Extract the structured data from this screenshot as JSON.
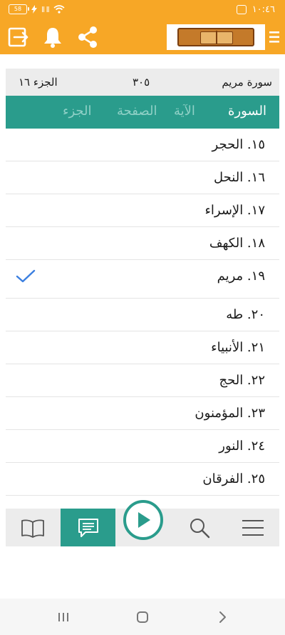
{
  "status_bar": {
    "battery": "58",
    "time": "١٠:٤٦",
    "signal": "ll ll",
    "icons": [
      "battery-icon",
      "bolt-icon",
      "signal-icon",
      "wifi-icon",
      "screen-record-icon"
    ]
  },
  "header": {
    "icons": [
      "exit-icon",
      "bell-icon",
      "share-icon",
      "app-logo",
      "menu-icon"
    ]
  },
  "info": {
    "sura": "سورة مريم",
    "page": "٣٠٥",
    "juz": "الجزء ١٦"
  },
  "tabs": [
    {
      "label": "السورة",
      "active": true
    },
    {
      "label": "الآية",
      "active": false
    },
    {
      "label": "الصفحة",
      "active": false
    },
    {
      "label": "الجزء",
      "active": false
    }
  ],
  "surahs": [
    {
      "label": "١٥. الحجر"
    },
    {
      "label": "١٦. النحل"
    },
    {
      "label": "١٧. الإسراء"
    },
    {
      "label": "١٨. الكهف"
    },
    {
      "label": "١٩. مريم",
      "selected": true
    },
    {
      "label": "٢٠. طه"
    },
    {
      "label": "٢١. الأنبياء"
    },
    {
      "label": "٢٢. الحج"
    },
    {
      "label": "٢٣. المؤمنون"
    },
    {
      "label": "٢٤. النور"
    },
    {
      "label": "٢٥. الفرقان"
    }
  ],
  "bottom_bar": {
    "icons": [
      "book-icon",
      "notes-icon",
      "play-icon",
      "search-icon",
      "hamburger-icon"
    ],
    "active": "notes-icon"
  },
  "colors": {
    "accent": "#f7a726",
    "teal": "#2a9c8c",
    "check": "#3b7fe0"
  }
}
